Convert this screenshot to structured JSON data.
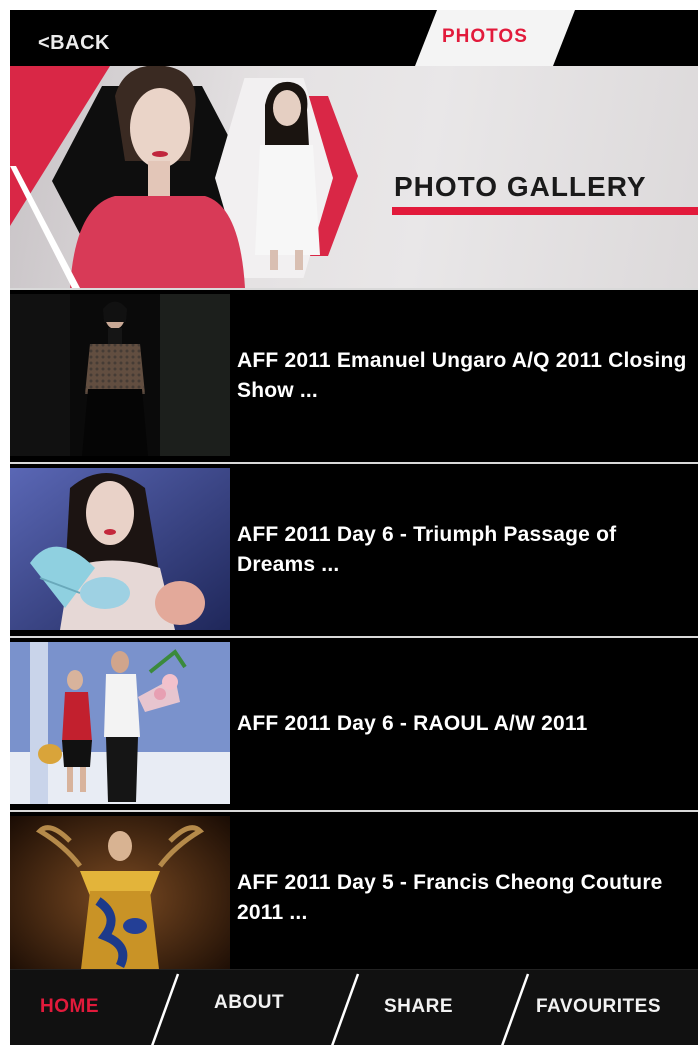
{
  "topbar": {
    "back_label": "<BACK",
    "active_tab": "PHOTOS"
  },
  "banner": {
    "title": "PHOTO GALLERY"
  },
  "gallery": {
    "items": [
      {
        "title": "AFF 2011 Emanuel Ungaro A/Q 2011 Closing Show ..."
      },
      {
        "title": "AFF 2011 Day 6 - Triumph Passage of Dreams ..."
      },
      {
        "title": "AFF 2011 Day 6 - RAOUL A/W 2011"
      },
      {
        "title": "AFF 2011 Day 5 - Francis Cheong Couture 2011 ..."
      }
    ]
  },
  "bottom_nav": {
    "items": [
      {
        "label": "HOME",
        "active": true
      },
      {
        "label": "ABOUT",
        "active": false
      },
      {
        "label": "SHARE",
        "active": false
      },
      {
        "label": "FAVOURITES",
        "active": false
      }
    ]
  },
  "colors": {
    "accent": "#e21a3b",
    "background": "#000000"
  }
}
